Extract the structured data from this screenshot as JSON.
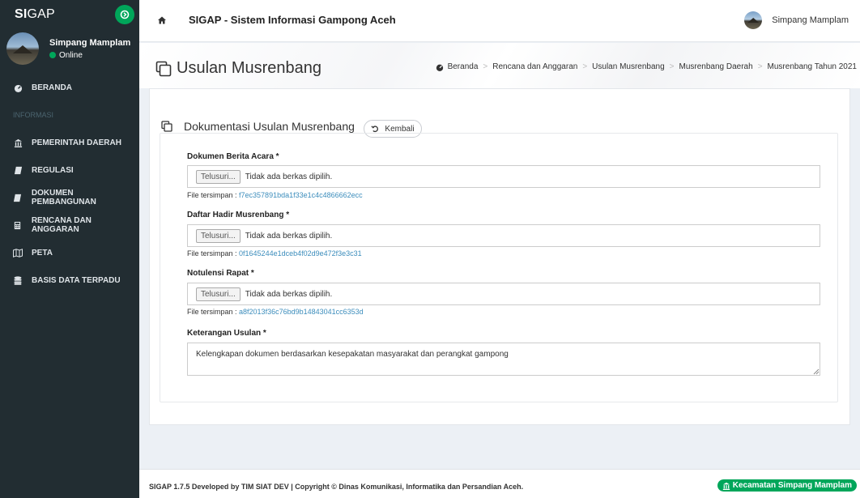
{
  "brand": {
    "bold": "SI",
    "rest": "GAP"
  },
  "user": {
    "name": "Simpang Mamplam",
    "status": "Online"
  },
  "sidebar": {
    "items": [
      {
        "label": "BERANDA",
        "icon": "dashboard-icon"
      },
      {
        "label": "INFORMASI",
        "header": true
      },
      {
        "label": "PEMERINTAH DAERAH",
        "icon": "institution-icon"
      },
      {
        "label": "REGULASI",
        "icon": "book-icon"
      },
      {
        "label": "DOKUMEN PEMBANGUNAN",
        "icon": "book-icon"
      },
      {
        "label": "RENCANA DAN ANGGARAN",
        "icon": "calculator-icon"
      },
      {
        "label": "PETA",
        "icon": "map-icon"
      },
      {
        "label": "BASIS DATA TERPADU",
        "icon": "database-icon"
      }
    ]
  },
  "header": {
    "title": "SIGAP - Sistem Informasi Gampong Aceh",
    "user_name": "Simpang Mamplam"
  },
  "page": {
    "title": "Usulan Musrenbang",
    "breadcrumb": [
      "Beranda",
      "Rencana dan Anggaran",
      "Usulan Musrenbang",
      "Musrenbang Daerah",
      "Musrenbang Tahun 2021"
    ]
  },
  "box": {
    "title": "Dokumentasi Usulan Musrenbang",
    "back_label": "Kembali"
  },
  "form": {
    "browse_label": "Telusuri...",
    "no_file_text": "Tidak ada berkas dipilih.",
    "saved_prefix": "File tersimpan : ",
    "fields": [
      {
        "label": "Dokumen Berita Acara *",
        "saved": "f7ec357891bda1f33e1c4c4866662ecc"
      },
      {
        "label": "Daftar Hadir Musrenbang *",
        "saved": "0f1645244e1dceb4f02d9e472f3e3c31"
      },
      {
        "label": "Notulensi Rapat *",
        "saved": "a8f2013f36c76bd9b14843041cc6353d"
      }
    ],
    "keterangan_label": "Keterangan Usulan *",
    "keterangan_value": "Kelengkapan dokumen berdasarkan kesepakatan masyarakat dan perangkat gampong"
  },
  "footer": {
    "text": "SIGAP 1.7.5 Developed by TIM SIAT DEV | Copyright © Dinas Komunikasi, Informatika dan Persandian Aceh.",
    "badge": "Kecamatan Simpang Mamplam"
  },
  "colors": {
    "sidebar": "#222d32",
    "accent": "#00a65a",
    "link": "#3c8dbc",
    "background": "#ecf0f5"
  }
}
